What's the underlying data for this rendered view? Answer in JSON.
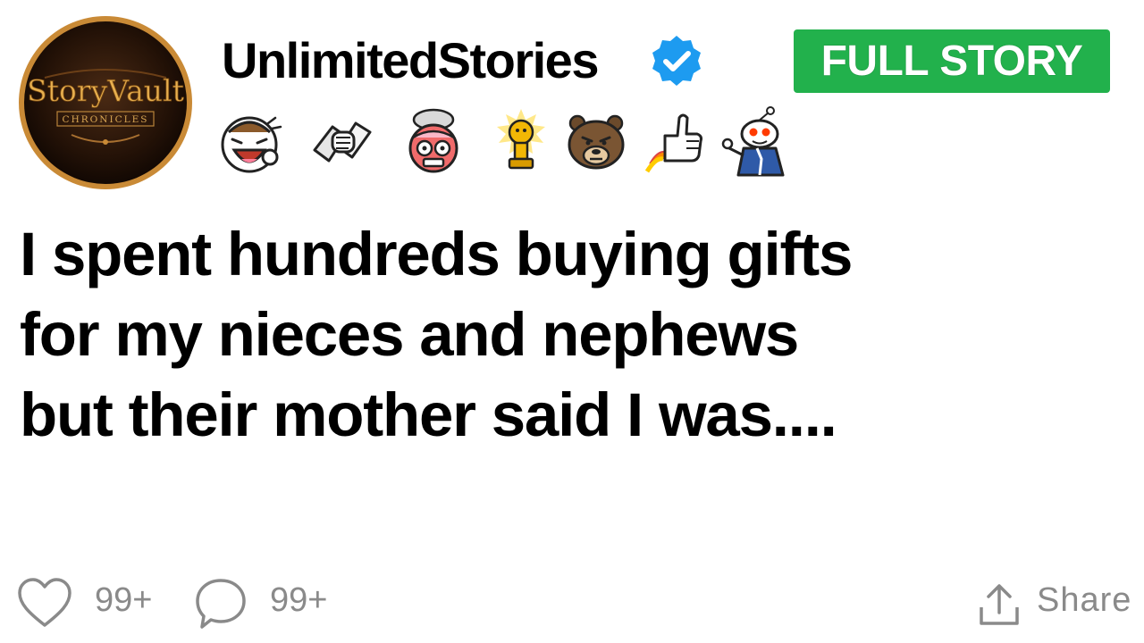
{
  "post": {
    "username": "UnlimitedStories",
    "verified": true,
    "badge_label": "FULL STORY",
    "avatar": {
      "title": "StoryVault",
      "subtitle": "CHRONICLES"
    },
    "awards": [
      "laughing-face-award-icon",
      "handshake-award-icon",
      "mind-blown-award-icon",
      "gold-trophy-award-icon",
      "bear-face-award-icon",
      "rocket-thumbs-up-award-icon",
      "snoo-pointing-award-icon"
    ],
    "headline_lines": [
      "I spent hundreds buying gifts",
      "for my nieces and nephews",
      "but their mother said I was...."
    ]
  },
  "actions": {
    "likes": "99+",
    "comments": "99+",
    "share_label": "Share"
  },
  "colors": {
    "badge": "#22b14c",
    "verified": "#1d9bf0",
    "muted": "#8a8a8a"
  }
}
